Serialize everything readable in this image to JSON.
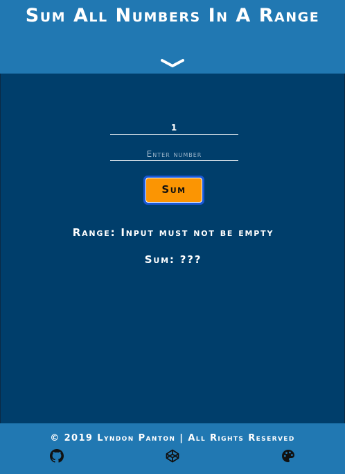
{
  "header": {
    "title": "Sum All Numbers In A Range",
    "toggle_icon": "chevron-down-icon"
  },
  "form": {
    "start_value": "1",
    "end_value": "",
    "end_placeholder": "Enter number",
    "submit_label": "Sum"
  },
  "results": {
    "range_text": "Range: Input must not be empty",
    "sum_text": "Sum: ???"
  },
  "footer": {
    "copyright": "© 2019 Lyndon Panton | All Rights Reserved",
    "icons": [
      "github-icon",
      "codepen-icon",
      "palette-icon"
    ]
  },
  "colors": {
    "header_bg": "#2178b2",
    "main_bg": "#003e6b",
    "button_bg": "#fb9503",
    "button_focus_ring": "#1a58d6",
    "text": "#ffffff"
  }
}
